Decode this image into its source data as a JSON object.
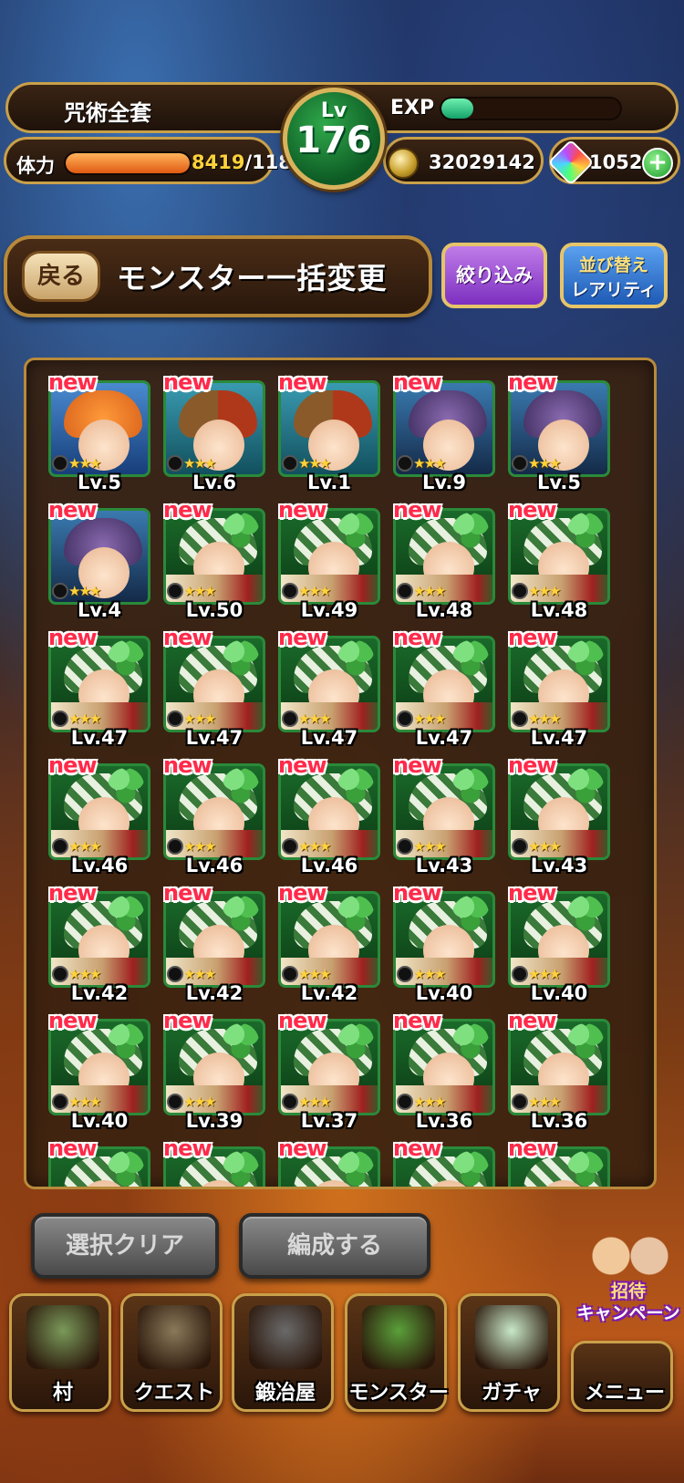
{
  "header": {
    "player_name": "咒術全套",
    "level_label": "Lv",
    "level": "176",
    "exp_label": "EXP",
    "exp_fill_fraction": 0.18,
    "stamina_label": "体力",
    "stamina_current": "8419",
    "stamina_max": "/118",
    "stamina_fill_fraction": 1.0,
    "coins": "32029142",
    "gems": "1052",
    "add_label": "+"
  },
  "title_bar": {
    "back_label": "戻る",
    "title": "モンスター一括変更",
    "filter_label": "絞り込み",
    "sort_label_top": "並び替え",
    "sort_label_bottom": "レアリティ"
  },
  "monsters": [
    {
      "new": "new",
      "level": "Lv.5",
      "stars": "★★★",
      "kind": "mage"
    },
    {
      "new": "new",
      "level": "Lv.6",
      "stars": "★★★",
      "kind": "pair"
    },
    {
      "new": "new",
      "level": "Lv.1",
      "stars": "★★★",
      "kind": "pair"
    },
    {
      "new": "new",
      "level": "Lv.9",
      "stars": "★★★",
      "kind": "dark"
    },
    {
      "new": "new",
      "level": "Lv.5",
      "stars": "★★★",
      "kind": "dark"
    },
    {
      "new": "new",
      "level": "Lv.4",
      "stars": "★★★",
      "kind": "dark"
    },
    {
      "new": "new",
      "level": "Lv.50",
      "stars": "★★★",
      "kind": "tree"
    },
    {
      "new": "new",
      "level": "Lv.49",
      "stars": "★★★",
      "kind": "tree"
    },
    {
      "new": "new",
      "level": "Lv.48",
      "stars": "★★★",
      "kind": "tree"
    },
    {
      "new": "new",
      "level": "Lv.48",
      "stars": "★★★",
      "kind": "tree"
    },
    {
      "new": "new",
      "level": "Lv.47",
      "stars": "★★★",
      "kind": "tree"
    },
    {
      "new": "new",
      "level": "Lv.47",
      "stars": "★★★",
      "kind": "tree"
    },
    {
      "new": "new",
      "level": "Lv.47",
      "stars": "★★★",
      "kind": "tree"
    },
    {
      "new": "new",
      "level": "Lv.47",
      "stars": "★★★",
      "kind": "tree"
    },
    {
      "new": "new",
      "level": "Lv.47",
      "stars": "★★★",
      "kind": "tree"
    },
    {
      "new": "new",
      "level": "Lv.46",
      "stars": "★★★",
      "kind": "tree"
    },
    {
      "new": "new",
      "level": "Lv.46",
      "stars": "★★★",
      "kind": "tree"
    },
    {
      "new": "new",
      "level": "Lv.46",
      "stars": "★★★",
      "kind": "tree"
    },
    {
      "new": "new",
      "level": "Lv.43",
      "stars": "★★★",
      "kind": "tree"
    },
    {
      "new": "new",
      "level": "Lv.43",
      "stars": "★★★",
      "kind": "tree"
    },
    {
      "new": "new",
      "level": "Lv.42",
      "stars": "★★★",
      "kind": "tree"
    },
    {
      "new": "new",
      "level": "Lv.42",
      "stars": "★★★",
      "kind": "tree"
    },
    {
      "new": "new",
      "level": "Lv.42",
      "stars": "★★★",
      "kind": "tree"
    },
    {
      "new": "new",
      "level": "Lv.40",
      "stars": "★★★",
      "kind": "tree"
    },
    {
      "new": "new",
      "level": "Lv.40",
      "stars": "★★★",
      "kind": "tree"
    },
    {
      "new": "new",
      "level": "Lv.40",
      "stars": "★★★",
      "kind": "tree"
    },
    {
      "new": "new",
      "level": "Lv.39",
      "stars": "★★★",
      "kind": "tree"
    },
    {
      "new": "new",
      "level": "Lv.37",
      "stars": "★★★",
      "kind": "tree"
    },
    {
      "new": "new",
      "level": "Lv.36",
      "stars": "★★★",
      "kind": "tree"
    },
    {
      "new": "new",
      "level": "Lv.36",
      "stars": "★★★",
      "kind": "tree"
    },
    {
      "new": "new",
      "level": "",
      "stars": "",
      "kind": "tree"
    },
    {
      "new": "new",
      "level": "",
      "stars": "",
      "kind": "tree"
    },
    {
      "new": "new",
      "level": "",
      "stars": "",
      "kind": "tree"
    },
    {
      "new": "new",
      "level": "",
      "stars": "",
      "kind": "tree"
    },
    {
      "new": "new",
      "level": "",
      "stars": "",
      "kind": "tree"
    }
  ],
  "actions": {
    "clear_label": "選択クリア",
    "form_label": "編成する"
  },
  "campaign": {
    "line1": "招待",
    "line2": "キャンペーン"
  },
  "nav": [
    {
      "label": "村",
      "icon": "village-icon",
      "color": "#7a9a5a"
    },
    {
      "label": "クエスト",
      "icon": "cave-icon",
      "color": "#8a7a5a"
    },
    {
      "label": "鍛冶屋",
      "icon": "hammer-icon",
      "color": "#6a6a6a"
    },
    {
      "label": "モンスター",
      "icon": "monster-icon",
      "color": "#5aa03a"
    },
    {
      "label": "ガチャ",
      "icon": "egg-icon",
      "color": "#c8e8c8"
    },
    {
      "label": "メニュー",
      "icon": "menu-icon",
      "color": "#a06a3a"
    }
  ]
}
